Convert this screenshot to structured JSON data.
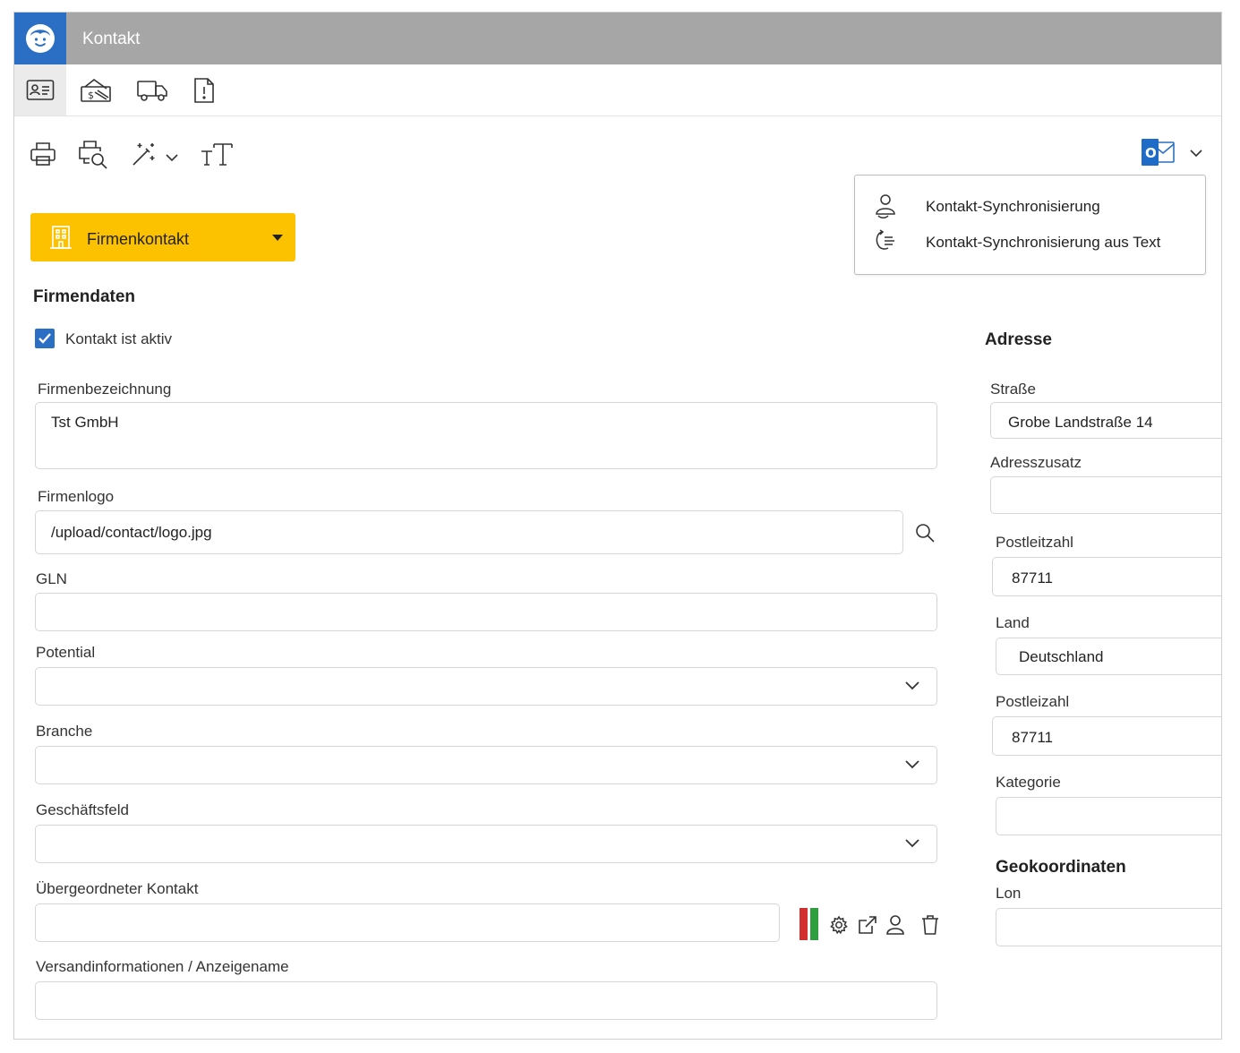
{
  "window": {
    "title": "Kontakt"
  },
  "tabs": [
    {
      "name": "contact-card-icon"
    },
    {
      "name": "money-hand-icon"
    },
    {
      "name": "truck-icon"
    },
    {
      "name": "document-alert-icon"
    }
  ],
  "toolbar": {
    "print": "print-icon",
    "print_preview": "print-preview-icon",
    "wand": "magic-wand-icon",
    "text_size": "text-size-icon",
    "outlook": "outlook-icon",
    "outlook_badge": "O"
  },
  "outlook_menu": {
    "items": [
      {
        "label": "Kontakt-Synchronisierung"
      },
      {
        "label": "Kontakt-Synchronisierung aus Text"
      }
    ]
  },
  "contact_type": {
    "label": "Firmenkontakt"
  },
  "firmendaten": {
    "title": "Firmendaten",
    "active_label": "Kontakt ist aktiv",
    "active_checked": true,
    "company_name_label": "Firmenbezeichnung",
    "company_name_value": "Tst GmbH",
    "logo_label": "Firmenlogo",
    "logo_value": "/upload/contact/logo.jpg",
    "gln_label": "GLN",
    "gln_value": "",
    "potential_label": "Potential",
    "branche_label": "Branche",
    "business_label": "Geschäftsfeld",
    "parent_label": "Übergeordneter Kontakt",
    "parent_value": "",
    "shipping_label": "Versandinformationen / Anzeigename",
    "shipping_value": ""
  },
  "adresse": {
    "title": "Adresse",
    "street_label": "Straße",
    "street_value": "Grobe Landstraße 14",
    "extra_label": "Adresszusatz",
    "extra_value": "",
    "zip_label": "Postleitzahl",
    "zip_value": "87711",
    "country_label": "Land",
    "country_value": "Deutschland",
    "zip2_label": "Postleizahl",
    "zip2_value": "87711",
    "category_label": "Kategorie",
    "category_value": "",
    "geo_title": "Geokoordinaten",
    "lon_label": "Lon",
    "lon_value": ""
  },
  "colors": {
    "accent": "#2a6fc4",
    "titlebar": "#a6a6a6",
    "type_select": "#fcc200",
    "status_red": "#d32f2f",
    "status_green": "#2e9e3f"
  }
}
